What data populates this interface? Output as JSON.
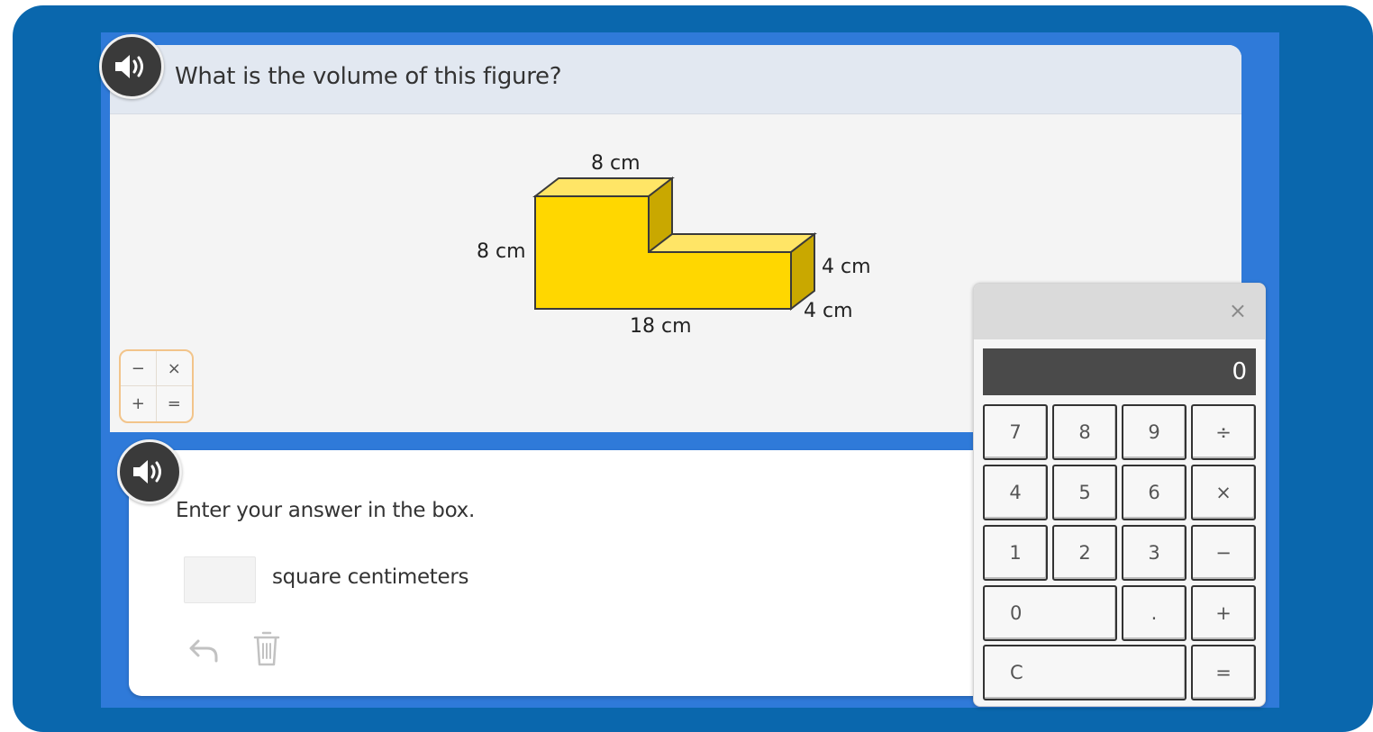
{
  "question": {
    "text": "What is the volume of this figure?"
  },
  "figure": {
    "labels": {
      "top": "8 cm",
      "left": "8 cm",
      "step_height": "4 cm",
      "depth": "4 cm",
      "bottom": "18 cm"
    },
    "colors": {
      "front": "#ffd700",
      "top": "#ffe566",
      "side": "#c9a800",
      "outline": "#3a3a3a"
    }
  },
  "ops_tool": {
    "minus": "−",
    "times": "×",
    "plus": "+",
    "equals": "="
  },
  "answer": {
    "prompt": "Enter your answer in the box.",
    "value": "",
    "unit": "square centimeters"
  },
  "calculator": {
    "close": "×",
    "display": "0",
    "keys": {
      "k7": "7",
      "k8": "8",
      "k9": "9",
      "div": "÷",
      "k4": "4",
      "k5": "5",
      "k6": "6",
      "mul": "×",
      "k1": "1",
      "k2": "2",
      "k3": "3",
      "sub": "−",
      "k0": "0",
      "dot": ".",
      "add": "+",
      "clear": "C",
      "eq": "="
    }
  },
  "colors": {
    "frame": "#0a67ad",
    "stage": "#2f7ad9",
    "header": "#e2e8f1"
  }
}
